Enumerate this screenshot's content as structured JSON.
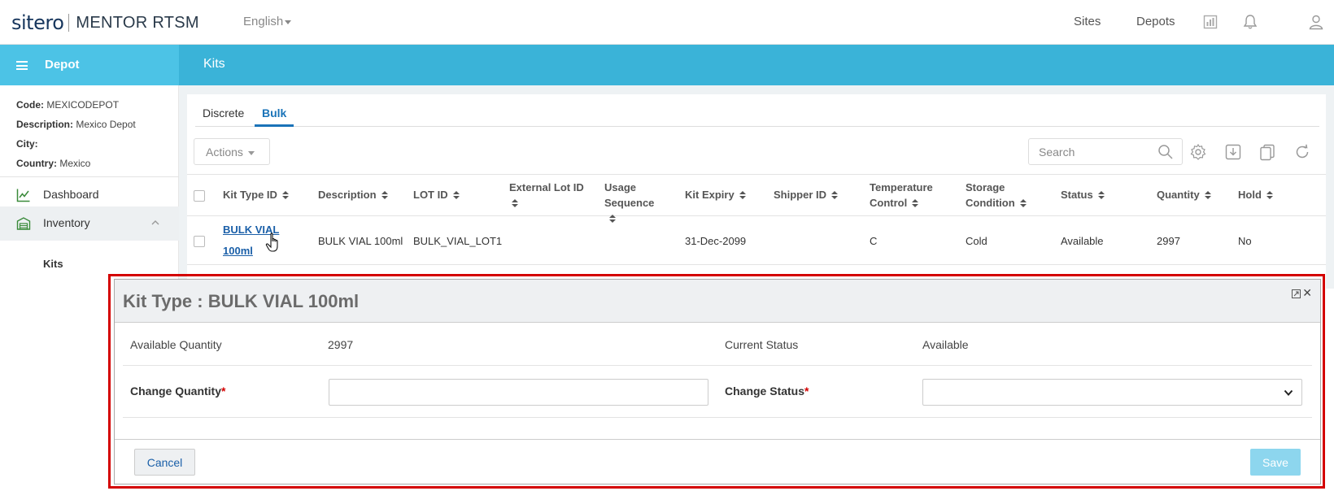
{
  "app": {
    "logo_brand": "sitero",
    "logo_product": "MENTOR RTSM",
    "language": "English",
    "nav_links": [
      "Sites",
      "Depots"
    ]
  },
  "sidebar": {
    "title": "Depot",
    "meta": [
      {
        "label": "Code:",
        "value": "MEXICODEPOT"
      },
      {
        "label": "Description:",
        "value": "Mexico Depot"
      },
      {
        "label": "City:",
        "value": ""
      },
      {
        "label": "Country:",
        "value": "Mexico"
      }
    ],
    "items": [
      {
        "label": "Dashboard",
        "icon": "chart-line-icon"
      },
      {
        "label": "Inventory",
        "icon": "warehouse-icon"
      }
    ],
    "sub_item": "Kits"
  },
  "page": {
    "title": "Kits",
    "tabs": [
      "Discrete",
      "Bulk"
    ],
    "active_tab": "Bulk",
    "actions_label": "Actions",
    "search_placeholder": "Search"
  },
  "table": {
    "headers": [
      "Kit Type ID",
      "Description",
      "LOT ID",
      "External Lot ID",
      "Usage Sequence",
      "Kit Expiry",
      "Shipper ID",
      "Temperature Control",
      "Storage Condition",
      "Status",
      "Quantity",
      "Hold"
    ],
    "rows": [
      {
        "kit_type_id": "BULK VIAL 100ml",
        "kit_type_id_line1": "BULK VIAL",
        "kit_type_id_line2": "100ml",
        "description": "BULK VIAL 100ml",
        "lot_id": "BULK_VIAL_LOT1",
        "external_lot_id": "",
        "usage_sequence": "",
        "kit_expiry": "31-Dec-2099",
        "shipper_id": "",
        "temperature_control": "C",
        "storage_condition": "Cold",
        "status": "Available",
        "quantity": "2997",
        "hold": "No"
      }
    ]
  },
  "modal": {
    "title": "Kit Type : BULK VIAL 100ml",
    "available_quantity_label": "Available Quantity",
    "available_quantity_value": "2997",
    "current_status_label": "Current Status",
    "current_status_value": "Available",
    "change_quantity_label": "Change Quantity",
    "change_status_label": "Change Status",
    "required_marker": "*",
    "change_quantity_value": "",
    "change_status_value": "",
    "cancel_label": "Cancel",
    "save_label": "Save"
  },
  "colors": {
    "header_blue": "#3ab3d8",
    "sidebar_header_blue": "#4cc3e6",
    "link_blue": "#1a5fa8",
    "highlight_red": "#d40000",
    "save_button": "#8dd6ee"
  }
}
